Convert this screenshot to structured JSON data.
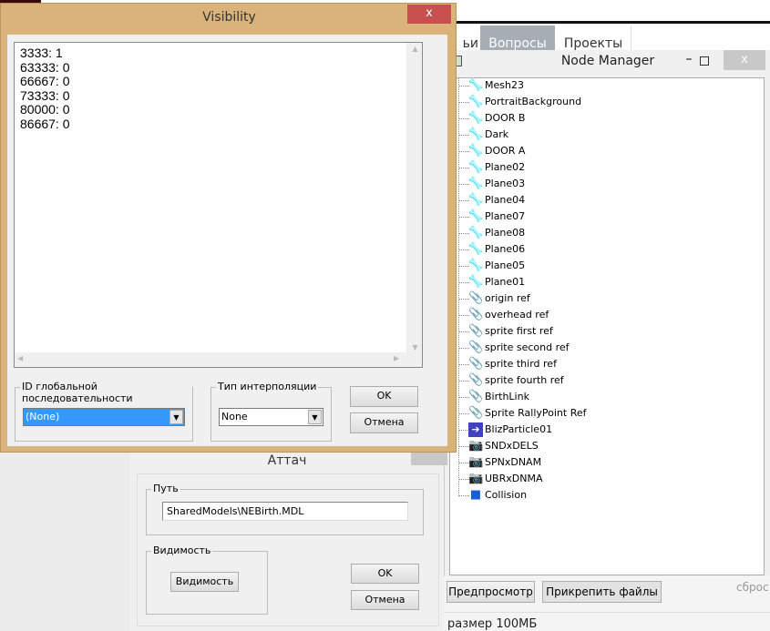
{
  "background": {
    "tabs": [
      "ьи",
      "Вопросы",
      "Проекты"
    ],
    "buttons": {
      "preview": "Предпросмотр",
      "attach_files": "Прикрепить файлы"
    },
    "reset_text": "сброс",
    "size_text": "размер 100МБ"
  },
  "node_manager": {
    "title": "Node Manager",
    "nodes": [
      {
        "label": "Mesh23",
        "icon": "bone-icon"
      },
      {
        "label": "PortraitBackground",
        "icon": "bone-icon"
      },
      {
        "label": "DOOR B",
        "icon": "bone-icon"
      },
      {
        "label": "Dark",
        "icon": "bone-icon"
      },
      {
        "label": "DOOR A",
        "icon": "bone-icon"
      },
      {
        "label": "Plane02",
        "icon": "bone-icon"
      },
      {
        "label": "Plane03",
        "icon": "bone-icon"
      },
      {
        "label": "Plane04",
        "icon": "bone-icon"
      },
      {
        "label": "Plane07",
        "icon": "bone-icon"
      },
      {
        "label": "Plane08",
        "icon": "bone-icon"
      },
      {
        "label": "Plane06",
        "icon": "bone-icon"
      },
      {
        "label": "Plane05",
        "icon": "bone-icon"
      },
      {
        "label": "Plane01",
        "icon": "bone-icon"
      },
      {
        "label": "origin ref",
        "icon": "paperclip-icon"
      },
      {
        "label": "overhead ref",
        "icon": "paperclip-icon"
      },
      {
        "label": "sprite first ref",
        "icon": "paperclip-icon"
      },
      {
        "label": "sprite second ref",
        "icon": "paperclip-icon"
      },
      {
        "label": "sprite third ref",
        "icon": "paperclip-icon"
      },
      {
        "label": "sprite fourth ref",
        "icon": "paperclip-icon"
      },
      {
        "label": "BirthLink",
        "icon": "paperclip-icon"
      },
      {
        "label": "Sprite RallyPoint Ref",
        "icon": "paperclip-icon"
      },
      {
        "label": "BlizParticle01",
        "icon": "particle-arrow-icon"
      },
      {
        "label": "SNDxDELS",
        "icon": "camera-icon"
      },
      {
        "label": "SPNxDNAM",
        "icon": "camera-icon"
      },
      {
        "label": "UBRxDNMA",
        "icon": "camera-icon"
      },
      {
        "label": "Collision",
        "icon": "cube-icon"
      }
    ]
  },
  "attach_dialog": {
    "title": "Аттач",
    "path_group": "Путь",
    "path_value": "SharedModels\\NEBirth.MDL",
    "visibility_group": "Видимость",
    "visibility_button": "Видимость",
    "ok": "OK",
    "cancel": "Отмена"
  },
  "visibility_dialog": {
    "title": "Visibility",
    "close": "x",
    "lines": [
      "3333: 1",
      "63333: 0",
      "66667: 0",
      "73333: 0",
      "80000: 0",
      "86667: 0"
    ],
    "global_seq_group": "ID глобальной последовательности",
    "global_seq_value": "(None)",
    "interp_group": "Тип интерполяции",
    "interp_value": "None",
    "ok": "OK",
    "cancel": "Отмена"
  },
  "colors": {
    "frame": "#d9b37a",
    "close": "#c7504f",
    "selection": "#3399ff",
    "bone": "#1e9be0"
  }
}
